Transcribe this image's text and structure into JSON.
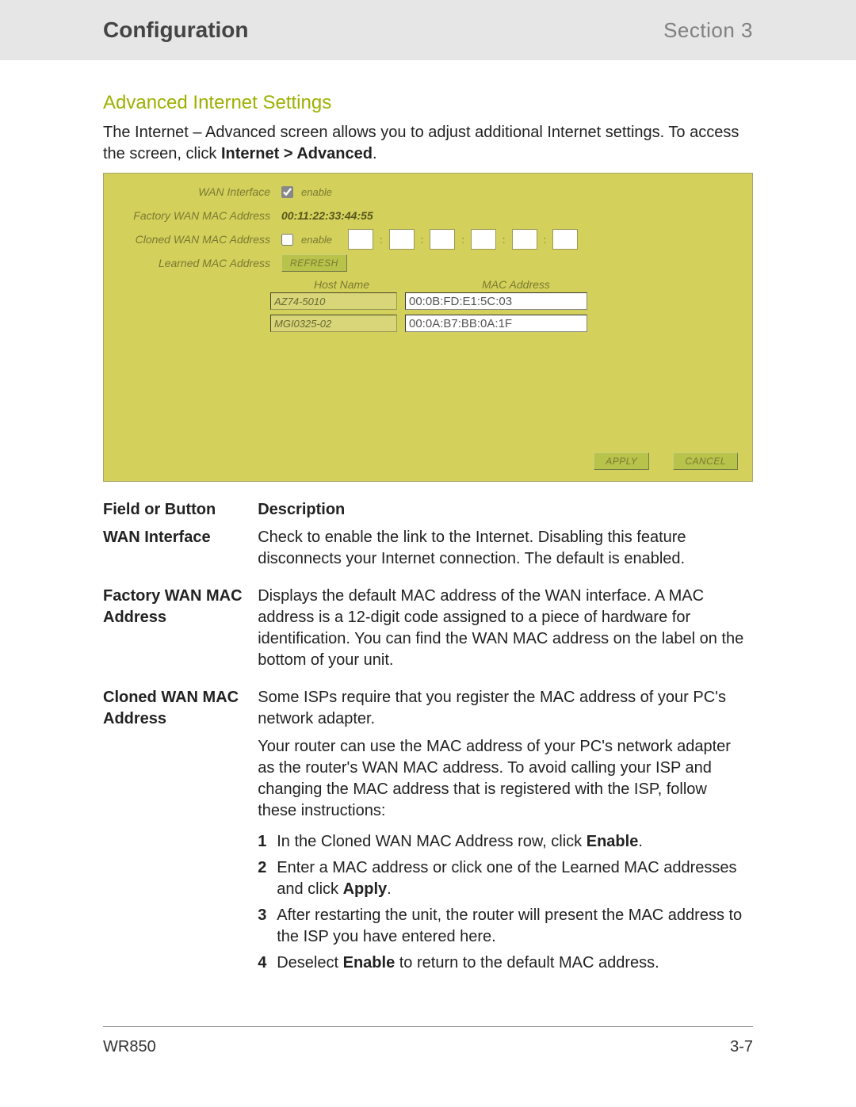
{
  "header": {
    "title": "Configuration",
    "section": "Section 3"
  },
  "section_heading": "Advanced Internet Settings",
  "intro": {
    "part1": "The Internet – Advanced screen allows you to adjust additional Internet settings. To access the screen, click ",
    "bold": "Internet > Advanced",
    "part2": "."
  },
  "panel": {
    "labels": {
      "wan_interface": "WAN Interface",
      "factory_mac": "Factory WAN MAC Address",
      "cloned_mac": "Cloned WAN MAC Address",
      "learned_mac": "Learned MAC Address"
    },
    "enable_text": "enable",
    "factory_mac_value": "00:11:22:33:44:55",
    "refresh": "REFRESH",
    "headers": {
      "host": "Host Name",
      "mac": "MAC Address"
    },
    "rows": [
      {
        "host": "AZ74-5010",
        "mac": "00:0B:FD:E1:5C:03"
      },
      {
        "host": "MGI0325-02",
        "mac": "00:0A:B7:BB:0A:1F"
      }
    ],
    "buttons": {
      "apply": "APPLY",
      "cancel": "CANCEL"
    }
  },
  "desc": {
    "headers": {
      "field": "Field or Button",
      "desc": "Description"
    },
    "wan_interface": {
      "label": "WAN Interface",
      "text": "Check to enable the link to the Internet. Disabling this feature disconnects your Internet connection. The default is enabled."
    },
    "factory_mac": {
      "label": "Factory WAN MAC Address",
      "text": "Displays the default MAC address of the WAN interface. A MAC address is a 12-digit code assigned to a piece of hardware for identification. You can find the WAN MAC address on the label on the bottom of your unit."
    },
    "cloned_mac": {
      "label": "Cloned WAN MAC Address",
      "para1": "Some ISPs require that you register the MAC address of your PC's network adapter.",
      "para2": "Your router can use the MAC address of your PC's network adapter as the router's WAN MAC address. To avoid calling your ISP and changing the MAC address that is registered with the ISP, follow these instructions:",
      "steps": [
        {
          "n": "1",
          "pre": "In the Cloned WAN MAC Address row, click ",
          "bold": "Enable",
          "post": "."
        },
        {
          "n": "2",
          "pre": "Enter a MAC address or click one of the Learned MAC addresses and click ",
          "bold": "Apply",
          "post": "."
        },
        {
          "n": "3",
          "pre": "After restarting the unit, the router will present the MAC address to the ISP you have entered here.",
          "bold": "",
          "post": ""
        },
        {
          "n": "4",
          "pre": "Deselect ",
          "bold": "Enable",
          "post": " to return to the default MAC address."
        }
      ]
    }
  },
  "footer": {
    "model": "WR850",
    "page": "3-7"
  }
}
